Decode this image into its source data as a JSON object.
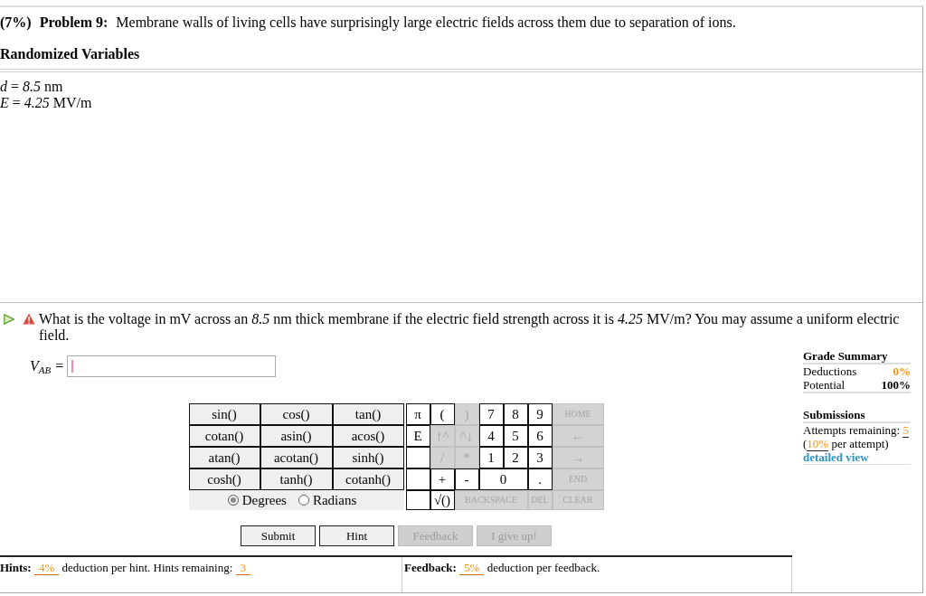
{
  "problem": {
    "weight": "(7%)",
    "label": "Problem 9:",
    "text": "Membrane walls of living cells have surprisingly large electric fields across them due to separation of ions."
  },
  "randomized_variables": {
    "title": "Randomized Variables",
    "items": [
      "*d* = *8.5* nm",
      "*E* = *4.25* MV/m"
    ]
  },
  "question": {
    "text": "What is the voltage in mV across an *8.5* nm thick membrane if the electric field strength across it is *4.25* MV/m? You may assume a uniform electric field."
  },
  "answer": {
    "label": "V$_{AB}$ =",
    "focused": true
  },
  "calculator": {
    "function_keys": [
      [
        "sin()",
        "cos()",
        "tan()"
      ],
      [
        "cotan()",
        "asin()",
        "acos()"
      ],
      [
        "atan()",
        "acotan()",
        "sinh()"
      ],
      [
        "cosh()",
        "tanh()",
        "cotanh()"
      ]
    ],
    "angle_modes": [
      {
        "label": "Degrees",
        "selected": true
      },
      {
        "label": "Radians",
        "selected": false
      }
    ],
    "keypad": [
      [
        {
          "label": "π",
          "kind": "key",
          "disabled": false
        },
        {
          "label": "(",
          "kind": "key",
          "disabled": false
        },
        {
          "label": ")",
          "kind": "key",
          "disabled": true
        },
        {
          "label": "7",
          "kind": "key",
          "disabled": false
        },
        {
          "label": "8",
          "kind": "key",
          "disabled": false
        },
        {
          "label": "9",
          "kind": "key",
          "disabled": false
        },
        {
          "label": "HOME",
          "kind": "key",
          "disabled": true
        }
      ],
      [
        {
          "label": "E",
          "kind": "key",
          "disabled": false
        },
        {
          "label": "↑^",
          "kind": "key",
          "disabled": true
        },
        {
          "label": "^↓",
          "kind": "key",
          "disabled": true
        },
        {
          "label": "4",
          "kind": "key",
          "disabled": false
        },
        {
          "label": "5",
          "kind": "key",
          "disabled": false
        },
        {
          "label": "6",
          "kind": "key",
          "disabled": false
        },
        {
          "label": "←",
          "kind": "key",
          "disabled": true
        }
      ],
      [
        {
          "kind": "blank"
        },
        {
          "label": "/",
          "kind": "key",
          "disabled": true
        },
        {
          "label": "*",
          "kind": "key",
          "disabled": true
        },
        {
          "label": "1",
          "kind": "key",
          "disabled": false
        },
        {
          "label": "2",
          "kind": "key",
          "disabled": false
        },
        {
          "label": "3",
          "kind": "key",
          "disabled": false
        },
        {
          "label": "→",
          "kind": "key",
          "disabled": true
        }
      ],
      [
        {
          "kind": "blank"
        },
        {
          "label": "+",
          "kind": "key",
          "disabled": false
        },
        {
          "label": "-",
          "kind": "key",
          "disabled": false
        },
        {
          "label": "0",
          "kind": "double",
          "disabled": false
        },
        {
          "label": ".",
          "kind": "key",
          "disabled": false
        },
        {
          "label": "END",
          "kind": "key",
          "disabled": true
        }
      ],
      [
        {
          "kind": "blank"
        },
        {
          "label": "√()",
          "kind": "key",
          "disabled": false
        },
        {
          "label": "BACKSPACE",
          "kind": "triple",
          "disabled": true
        },
        {
          "label": "DEL",
          "kind": "key",
          "disabled": true
        },
        {
          "label": "CLEAR",
          "kind": "key",
          "disabled": true
        }
      ]
    ]
  },
  "buttons": [
    {
      "label": "Submit",
      "disabled": false
    },
    {
      "label": "Hint",
      "disabled": false
    },
    {
      "label": "Feedback",
      "disabled": true
    },
    {
      "label": "I give up!",
      "disabled": true
    }
  ],
  "grade_summary": {
    "title": "Grade Summary",
    "rows": [
      {
        "label": "Deductions",
        "value": "0%",
        "kind": "deduction"
      },
      {
        "label": "Potential",
        "value": "100%",
        "kind": "total"
      }
    ]
  },
  "submissions": {
    "title": "Submissions",
    "segments": [
      {
        "text": "Attempts remaining: ",
        "kind": "plain"
      },
      {
        "text": "5",
        "kind": "value"
      },
      {
        "text": " (",
        "kind": "plain"
      },
      {
        "text": "10%",
        "kind": "value"
      },
      {
        "text": " per attempt)",
        "kind": "plain"
      }
    ],
    "link": "detailed view"
  },
  "hints": {
    "segments": [
      {
        "text": "Hints: ",
        "kind": "label"
      },
      {
        "text": "4%",
        "kind": "value"
      },
      {
        "text": " deduction per hint. Hints remaining: ",
        "kind": "plain"
      },
      {
        "text": "3",
        "kind": "value"
      }
    ]
  },
  "feedback": {
    "segments": [
      {
        "text": "Feedback: ",
        "kind": "label"
      },
      {
        "text": "5%",
        "kind": "value"
      },
      {
        "text": " deduction per feedback.",
        "kind": "plain"
      }
    ]
  }
}
